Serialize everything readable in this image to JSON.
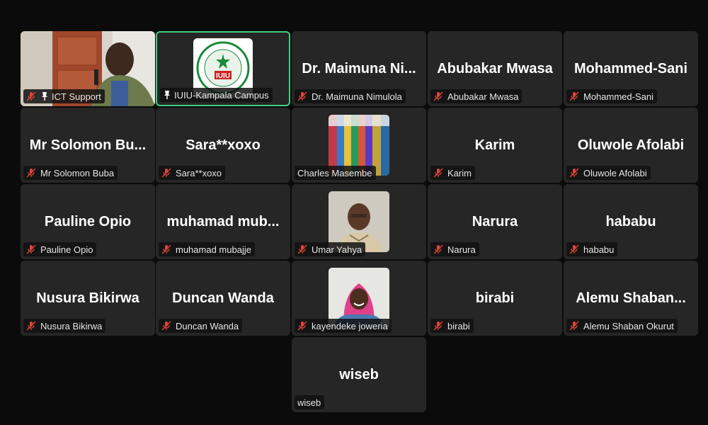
{
  "tiles": [
    {
      "label": "ICT Support",
      "big": "",
      "icons": "mic-pin"
    },
    {
      "label": "IUIU-Kampala Campus",
      "big": "",
      "icons": "pin"
    },
    {
      "label": "Dr. Maimuna Nimulola",
      "big": "Dr. Maimuna Ni...",
      "icons": "mic"
    },
    {
      "label": "Abubakar Mwasa",
      "big": "Abubakar Mwasa",
      "icons": "mic"
    },
    {
      "label": "Mohammed-Sani",
      "big": "Mohammed-Sani",
      "icons": "mic"
    },
    {
      "label": "Mr Solomon Buba",
      "big": "Mr Solomon Bu...",
      "icons": "mic"
    },
    {
      "label": "Sara**xoxo",
      "big": "Sara**xoxo",
      "icons": "mic"
    },
    {
      "label": "Charles Masembe",
      "big": "",
      "icons": "none"
    },
    {
      "label": "Karim",
      "big": "Karim",
      "icons": "mic"
    },
    {
      "label": "Oluwole Afolabi",
      "big": "Oluwole Afolabi",
      "icons": "mic"
    },
    {
      "label": "Pauline Opio",
      "big": "Pauline Opio",
      "icons": "mic"
    },
    {
      "label": "muhamad mubajje",
      "big": "muhamad  mub...",
      "icons": "mic"
    },
    {
      "label": "Umar Yahya",
      "big": "",
      "icons": "mic"
    },
    {
      "label": "Narura",
      "big": "Narura",
      "icons": "mic"
    },
    {
      "label": "hababu",
      "big": "hababu",
      "icons": "mic"
    },
    {
      "label": "Nusura Bikirwa",
      "big": "Nusura Bikirwa",
      "icons": "mic"
    },
    {
      "label": "Duncan Wanda",
      "big": "Duncan Wanda",
      "icons": "mic"
    },
    {
      "label": "kayendeke joweria",
      "big": "",
      "icons": "mic"
    },
    {
      "label": "birabi",
      "big": "birabi",
      "icons": "mic"
    },
    {
      "label": "Alemu Shaban  Okurut",
      "big": "Alemu  Shaban...",
      "icons": "mic"
    },
    {
      "label": "wiseb",
      "big": "wiseb",
      "icons": "none"
    }
  ],
  "logo": {
    "text": "IUIU"
  },
  "colors": {
    "active_border": "#3fcf7f",
    "muted_icon": "#e0453a",
    "tile_bg": "#262626"
  }
}
